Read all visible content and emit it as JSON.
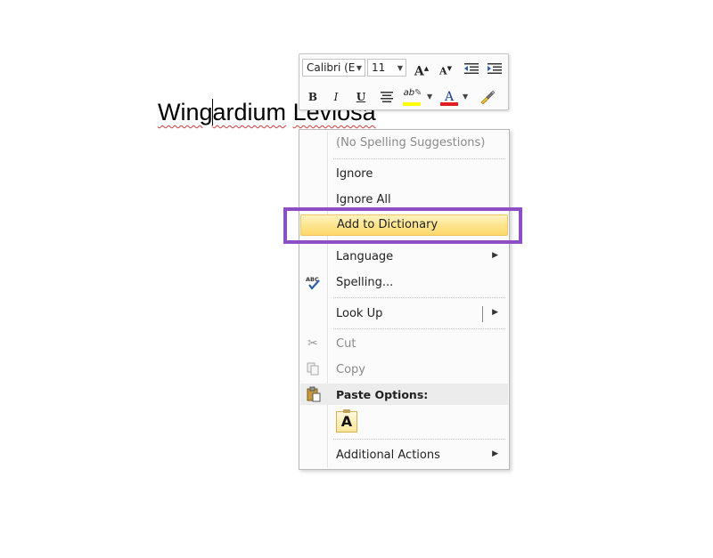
{
  "document": {
    "word1_part1": "Wing",
    "word1_part2": "ardium",
    "word2": "Leviosa"
  },
  "mini_toolbar": {
    "font_name": "Calibri (E",
    "font_size": "11",
    "grow_font_label": "A",
    "shrink_font_label": "A",
    "bold_label": "B",
    "italic_label": "I",
    "underline_label": "U",
    "highlight_label": "ab",
    "font_color_label": "A",
    "highlight_color": "#ffff00",
    "font_color": "#e02020"
  },
  "context_menu": {
    "no_suggestions": "(No Spelling Suggestions)",
    "ignore": "Ignore",
    "ignore_all": "Ignore All",
    "add_to_dictionary": "Add to Dictionary",
    "language": "Language",
    "spelling": "Spelling...",
    "look_up": "Look Up",
    "cut": "Cut",
    "copy": "Copy",
    "paste_options": "Paste Options:",
    "paste_keep_text": "A",
    "additional_actions": "Additional Actions",
    "spelling_icon_text": "ABC",
    "annotation_color": "#8e4ec6",
    "highlight_color": "#fde48a"
  }
}
